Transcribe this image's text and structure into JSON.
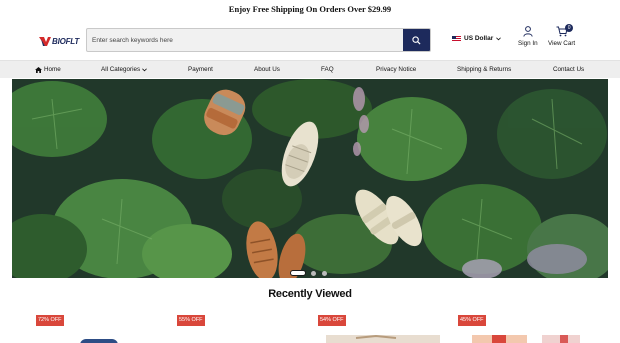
{
  "promo": {
    "text": "Enjoy Free Shipping On Orders Over $29.99"
  },
  "header": {
    "logo_text": "BIOFLT",
    "search_placeholder": "Enter search keywords here",
    "currency": "US Dollar",
    "signin_label": "Sign In",
    "cart_label": "View Cart",
    "cart_count": "0"
  },
  "nav": {
    "items": [
      {
        "label": "Home"
      },
      {
        "label": "All Categories"
      },
      {
        "label": "Payment"
      },
      {
        "label": "About Us"
      },
      {
        "label": "FAQ"
      },
      {
        "label": "Privacy Notice"
      },
      {
        "label": "Shipping & Returns"
      },
      {
        "label": "Contact Us"
      }
    ]
  },
  "hero": {
    "slide_count": 3,
    "active_slide": 1
  },
  "recently_viewed": {
    "title": "Recently Viewed",
    "products": [
      {
        "discount": "72% OFF"
      },
      {
        "discount": "55% OFF"
      },
      {
        "discount": "54% OFF"
      },
      {
        "discount": "45% OFF"
      }
    ]
  },
  "colors": {
    "brand_navy": "#1d2a5c",
    "discount_red": "#d9473b",
    "nav_bg": "#eeeeee"
  }
}
